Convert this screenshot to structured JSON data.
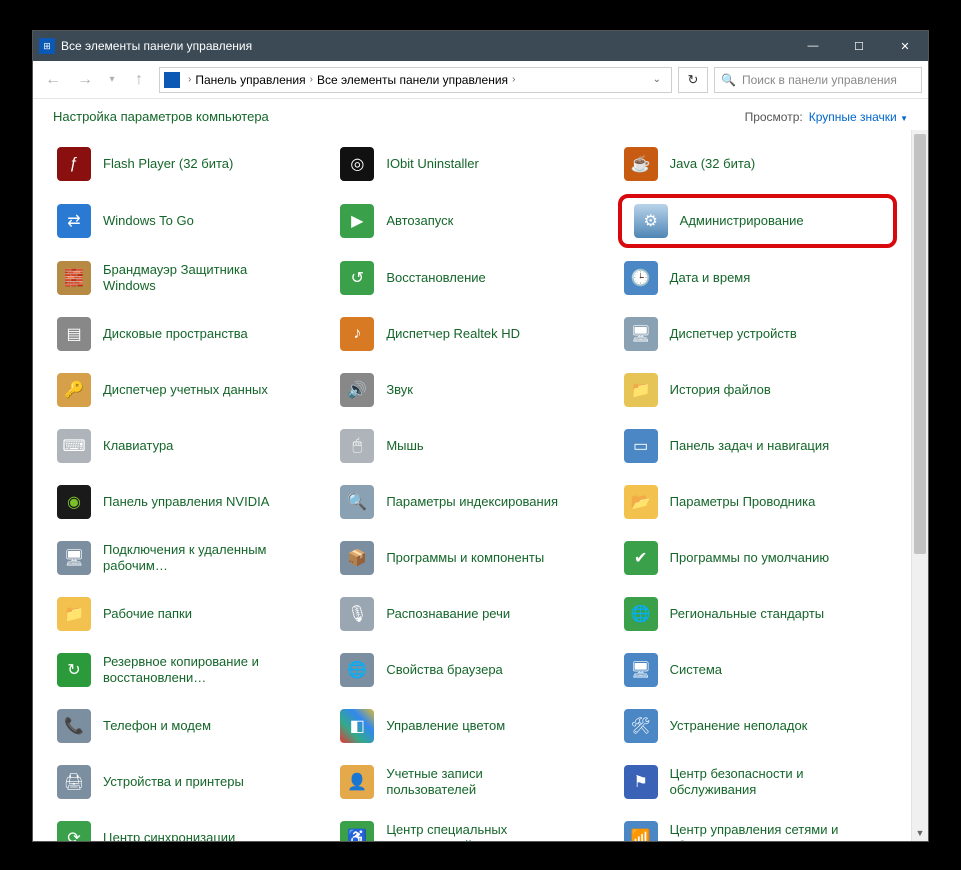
{
  "window": {
    "title": "Все элементы панели управления"
  },
  "titlebar": {
    "minimize": "—",
    "maximize": "☐",
    "close": "✕"
  },
  "nav": {
    "back": "←",
    "forward": "→",
    "drop": "▾",
    "up": "↑",
    "refresh": "↻"
  },
  "breadcrumb": {
    "seg1": "Панель управления",
    "seg2": "Все элементы панели управления",
    "chevron": "›",
    "drop": "⌄"
  },
  "search": {
    "placeholder": "Поиск в панели управления",
    "glyph": "🔍"
  },
  "subhead": {
    "title": "Настройка параметров компьютера",
    "view_label": "Просмотр:",
    "view_value": "Крупные значки",
    "chev": "▼"
  },
  "items": [
    {
      "label": "Flash Player (32 бита)",
      "iconClass": "i-flash",
      "glyph": "ƒ"
    },
    {
      "label": "IObit Uninstaller",
      "iconClass": "i-iobit",
      "glyph": "◎"
    },
    {
      "label": "Java (32 бита)",
      "iconClass": "i-java",
      "glyph": "☕"
    },
    {
      "label": "Windows To Go",
      "iconClass": "i-win2go",
      "glyph": "⇄"
    },
    {
      "label": "Автозапуск",
      "iconClass": "i-autorun",
      "glyph": "▶"
    },
    {
      "label": "Администрирование",
      "iconClass": "i-admin",
      "glyph": "⚙",
      "highlight": true
    },
    {
      "label": "Брандмауэр Защитника Windows",
      "iconClass": "i-firewall",
      "glyph": "🧱"
    },
    {
      "label": "Восстановление",
      "iconClass": "i-restore",
      "glyph": "↺"
    },
    {
      "label": "Дата и время",
      "iconClass": "i-date",
      "glyph": "🕒"
    },
    {
      "label": "Дисковые пространства",
      "iconClass": "i-disk",
      "glyph": "▤"
    },
    {
      "label": "Диспетчер Realtek HD",
      "iconClass": "i-realtek",
      "glyph": "♪"
    },
    {
      "label": "Диспетчер устройств",
      "iconClass": "i-device",
      "glyph": "🖥"
    },
    {
      "label": "Диспетчер учетных данных",
      "iconClass": "i-userdisp",
      "glyph": "🔑"
    },
    {
      "label": "Звук",
      "iconClass": "i-sound",
      "glyph": "🔊"
    },
    {
      "label": "История файлов",
      "iconClass": "i-filehist",
      "glyph": "📁"
    },
    {
      "label": "Клавиатура",
      "iconClass": "i-keyboard",
      "glyph": "⌨"
    },
    {
      "label": "Мышь",
      "iconClass": "i-mouse",
      "glyph": "🖱"
    },
    {
      "label": "Панель задач и навигация",
      "iconClass": "i-taskbar",
      "glyph": "▭"
    },
    {
      "label": "Панель управления NVIDIA",
      "iconClass": "i-nvidia",
      "glyph": "◉"
    },
    {
      "label": "Параметры индексирования",
      "iconClass": "i-index",
      "glyph": "🔍"
    },
    {
      "label": "Параметры Проводника",
      "iconClass": "i-explorer",
      "glyph": "📂"
    },
    {
      "label": "Подключения к удаленным рабочим…",
      "iconClass": "i-rdp",
      "glyph": "🖥"
    },
    {
      "label": "Программы и компоненты",
      "iconClass": "i-programs",
      "glyph": "📦"
    },
    {
      "label": "Программы по умолчанию",
      "iconClass": "i-defaults",
      "glyph": "✔"
    },
    {
      "label": "Рабочие папки",
      "iconClass": "i-folders",
      "glyph": "📁"
    },
    {
      "label": "Распознавание речи",
      "iconClass": "i-speech",
      "glyph": "🎙"
    },
    {
      "label": "Региональные стандарты",
      "iconClass": "i-region",
      "glyph": "🌐"
    },
    {
      "label": "Резервное копирование и восстановлени…",
      "iconClass": "i-backup",
      "glyph": "↻"
    },
    {
      "label": "Свойства браузера",
      "iconClass": "i-inetopt",
      "glyph": "🌐"
    },
    {
      "label": "Система",
      "iconClass": "i-system",
      "glyph": "🖥"
    },
    {
      "label": "Телефон и модем",
      "iconClass": "i-phone",
      "glyph": "📞"
    },
    {
      "label": "Управление цветом",
      "iconClass": "i-color",
      "glyph": "◧"
    },
    {
      "label": "Устранение неполадок",
      "iconClass": "i-trouble",
      "glyph": "🛠"
    },
    {
      "label": "Устройства и принтеры",
      "iconClass": "i-printers",
      "glyph": "🖨"
    },
    {
      "label": "Учетные записи пользователей",
      "iconClass": "i-users",
      "glyph": "👤"
    },
    {
      "label": "Центр безопасности и обслуживания",
      "iconClass": "i-security",
      "glyph": "⚑"
    },
    {
      "label": "Центр синхронизации",
      "iconClass": "i-sync",
      "glyph": "⟳"
    },
    {
      "label": "Центр специальных возможностей",
      "iconClass": "i-easeacc",
      "glyph": "♿"
    },
    {
      "label": "Центр управления сетями и общим доступом",
      "iconClass": "i-netshare",
      "glyph": "📶"
    }
  ]
}
